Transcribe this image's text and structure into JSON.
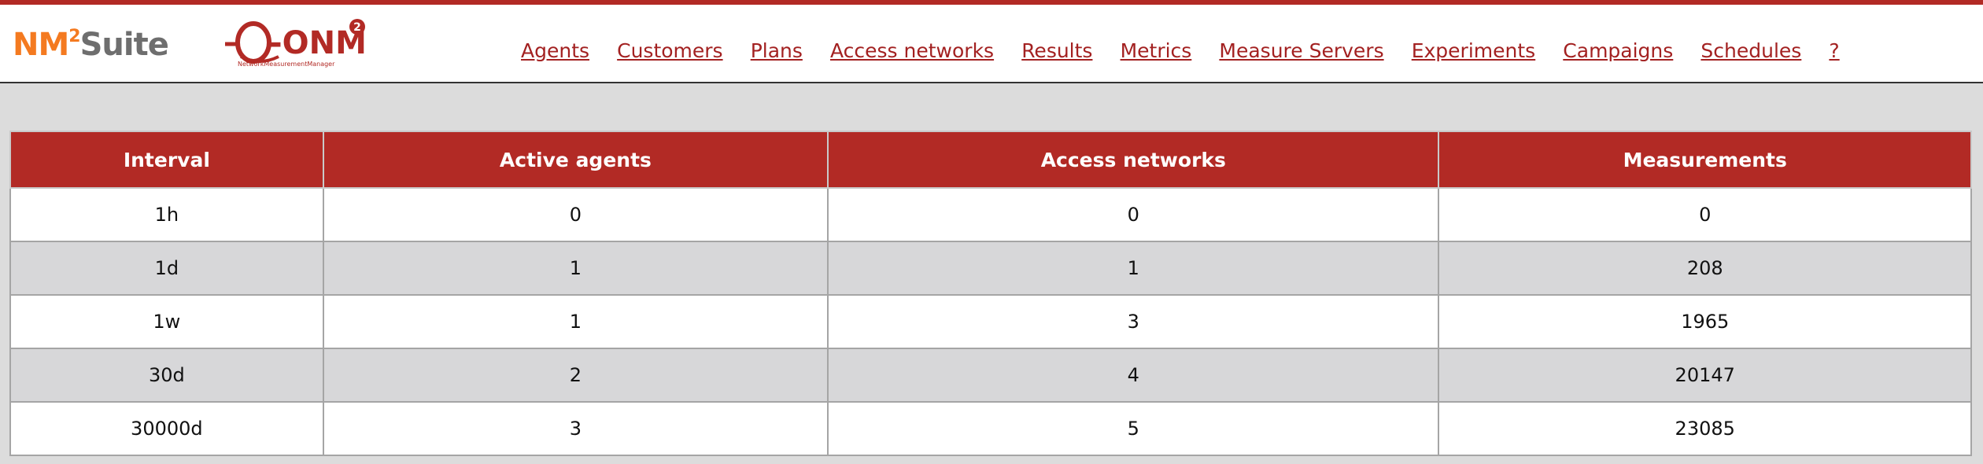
{
  "brand": {
    "nm": "NM",
    "sup": "2",
    "suite": "Suite",
    "logo_text": "-ONM",
    "logo_sup": "2",
    "logo_tagline": "NetworkMeasurementManager"
  },
  "nav": {
    "items": [
      "Agents",
      "Customers",
      "Plans",
      "Access networks",
      "Results",
      "Metrics",
      "Measure Servers",
      "Experiments",
      "Campaigns",
      "Schedules",
      "?"
    ]
  },
  "table": {
    "headers": [
      "Interval",
      "Active agents",
      "Access networks",
      "Measurements"
    ],
    "rows": [
      [
        "1h",
        "0",
        "0",
        "0"
      ],
      [
        "1d",
        "1",
        "1",
        "208"
      ],
      [
        "1w",
        "1",
        "3",
        "1965"
      ],
      [
        "30d",
        "2",
        "4",
        "20147"
      ],
      [
        "30000d",
        "3",
        "5",
        "23085"
      ]
    ]
  },
  "colors": {
    "accent": "#b22a25",
    "link": "#a32121",
    "brand_orange": "#f47a20",
    "brand_gray": "#6e6e6e",
    "background": "#dcdcdc",
    "row_alt": "#d7d7d9"
  }
}
